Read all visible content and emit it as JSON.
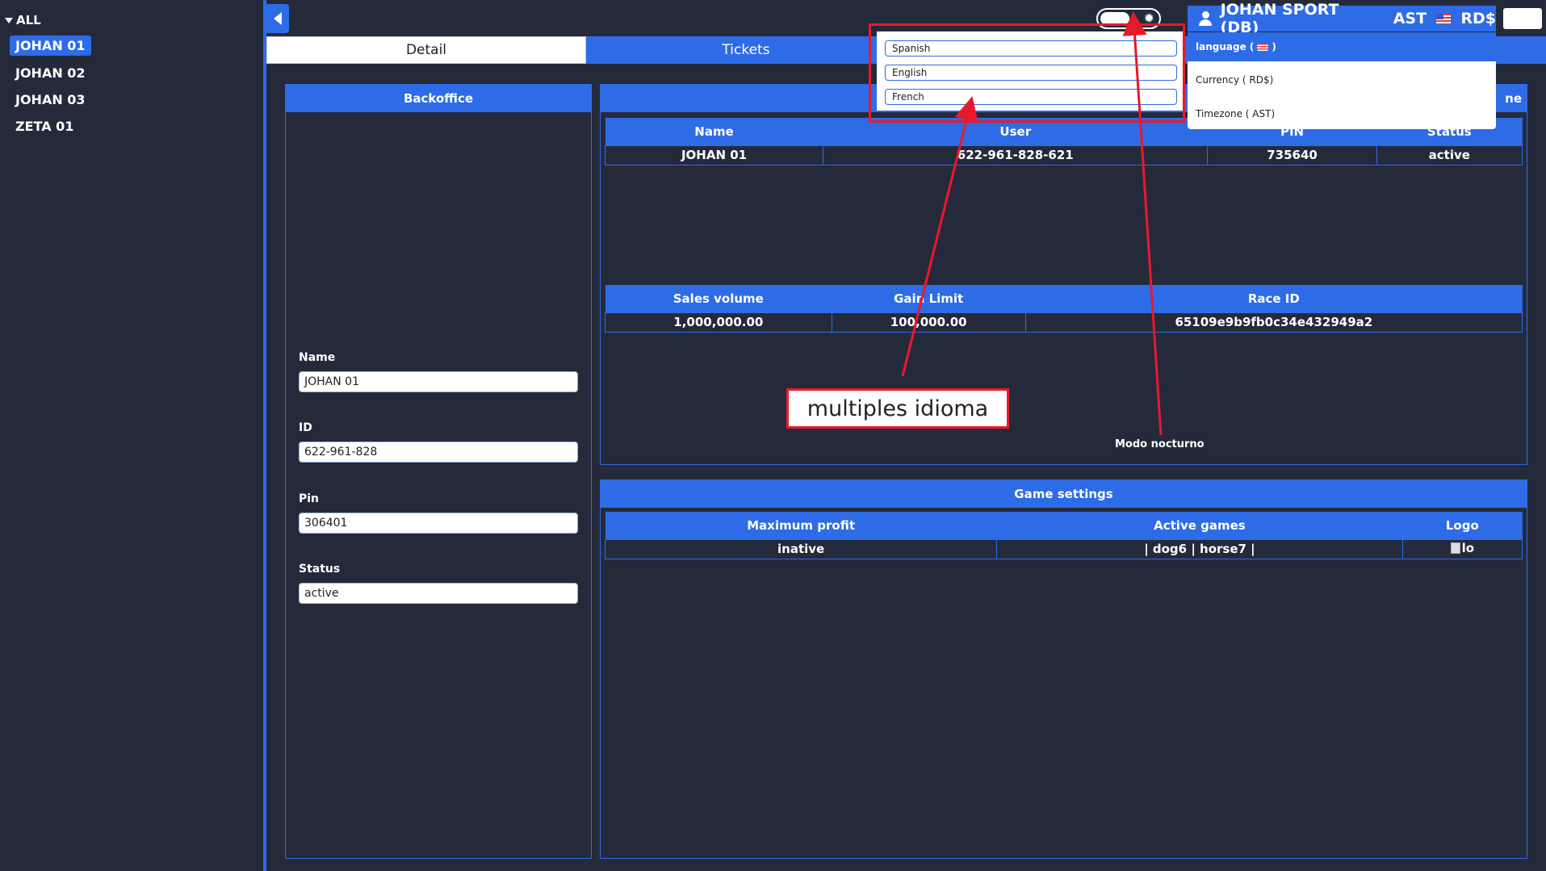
{
  "sidebar": {
    "root_label": "ALL",
    "items": [
      {
        "label": "JOHAN 01",
        "active": true
      },
      {
        "label": "JOHAN 02",
        "active": false
      },
      {
        "label": "JOHAN 03",
        "active": false
      },
      {
        "label": "ZETA 01",
        "active": false
      }
    ]
  },
  "tabs": [
    {
      "label": "Detail",
      "active": true
    },
    {
      "label": "Tickets",
      "active": false
    }
  ],
  "header": {
    "user_name": "JOHAN SPORT (DB)",
    "timezone": "AST",
    "currency": "RD$"
  },
  "settings_menu": {
    "language_label": "language (",
    "language_suffix": ")",
    "currency_label": "Currency ( RD$)",
    "timezone_label": "Timezone ( AST)"
  },
  "language_popup": {
    "options": [
      "Spanish",
      "English",
      "French"
    ]
  },
  "backoffice": {
    "title": "Backoffice",
    "fields": [
      {
        "label": "Name",
        "value": "JOHAN 01"
      },
      {
        "label": "ID",
        "value": "622-961-828"
      },
      {
        "label": "Pin",
        "value": "306401"
      },
      {
        "label": "Status",
        "value": "active"
      }
    ]
  },
  "info_panel": {
    "title_tail": "ne",
    "table1": {
      "headers": [
        "Name",
        "User",
        "PIN",
        "Status"
      ],
      "row": [
        "JOHAN 01",
        "622-961-828-621",
        "735640",
        "active"
      ]
    },
    "table2": {
      "headers": [
        "Sales volume",
        "Gain Limit",
        "Race ID"
      ],
      "row": [
        "1,000,000.00",
        "100,000.00",
        "65109e9b9fb0c34e432949a2"
      ]
    }
  },
  "game_settings": {
    "title": "Game settings",
    "headers": [
      "Maximum profit",
      "Active games",
      "Logo"
    ],
    "row": [
      "inative",
      "| dog6 | horse7 |",
      "lo"
    ]
  },
  "annotations": {
    "languages_note": "multiples idioma",
    "night_mode_note": "Modo nocturno",
    "highlight_color": "#e8192b"
  },
  "colors": {
    "accent": "#2e6be6",
    "background": "#252a3b"
  }
}
